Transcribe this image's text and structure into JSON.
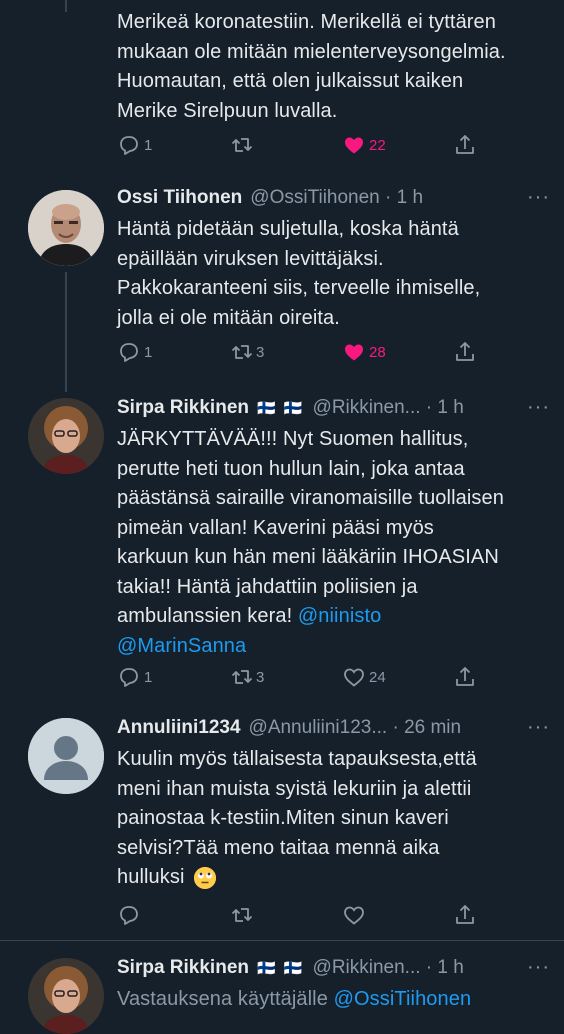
{
  "tweets": [
    {
      "body_lines": [
        "Merikeä koronatestiin. Merikellä ei tyttären",
        "mukaan ole mitään mielenterveysongelmia.",
        "Huomautan, että olen julkaissut kaiken",
        "Merike Sirelpuun luvalla."
      ],
      "replies": "1",
      "retweets": "",
      "likes": "22",
      "liked": true
    },
    {
      "name": "Ossi Tiihonen",
      "handle": "@OssiTiihonen · 1 h",
      "more": "···",
      "body_lines": [
        "Häntä pidetään suljetulla, koska häntä",
        "epäillään viruksen levittäjäksi.",
        "Pakkokaranteeni siis, terveelle ihmiselle,",
        "jolla ei ole mitään oireita."
      ],
      "replies": "1",
      "retweets": "3",
      "likes": "28",
      "liked": true
    },
    {
      "name": "Sirpa Rikkinen",
      "flags": "🇫🇮 🇫🇮",
      "handle": "@Rikkinen... · 1 h",
      "more": "···",
      "body_lines": [
        "JÄRKYTTÄVÄÄ!!! Nyt Suomen hallitus,",
        "perutte heti tuon hullun lain, joka antaa",
        "päästänsä sairaille viranomaisille tuollaisen",
        "pimeän vallan! Kaverini pääsi myös",
        "karkuun kun hän meni lääkäriin IHOASIAN",
        "takia!! Häntä jahdattiin poliisien ja"
      ],
      "line7_text": "ambulanssien kera! ",
      "mention1": "@niinisto",
      "mention2": "@MarinSanna",
      "replies": "1",
      "retweets": "3",
      "likes": "24",
      "liked": false
    },
    {
      "name": "Annuliini1234",
      "handle": "@Annuliini123... · 26 min",
      "more": "···",
      "body_lines": [
        "Kuulin myös tällaisesta tapauksesta,että",
        "meni ihan muista syistä lekuriin ja alettii",
        "painostaa k-testiin.Miten sinun kaveri",
        "selvisi?Tää meno taitaa mennä aika"
      ],
      "last_line": "hulluksi",
      "emoji": "eye-roll-emoji",
      "replies": "",
      "retweets": "",
      "likes": "",
      "liked": false
    },
    {
      "name": "Sirpa Rikkinen",
      "flags": "🇫🇮 🇫🇮",
      "handle": "@Rikkinen... · 1 h",
      "more": "···",
      "reply_prefix": "Vastauksena käyttäjälle ",
      "reply_to": "@OssiTiihonen"
    }
  ],
  "colors": {
    "background": "#15202b",
    "text": "#e7e9ea",
    "muted": "#8b98a5",
    "like": "#f91880",
    "link": "#1d9bf0"
  },
  "icons": [
    "reply-icon",
    "retweet-icon",
    "heart-icon",
    "share-icon",
    "more-icon"
  ]
}
